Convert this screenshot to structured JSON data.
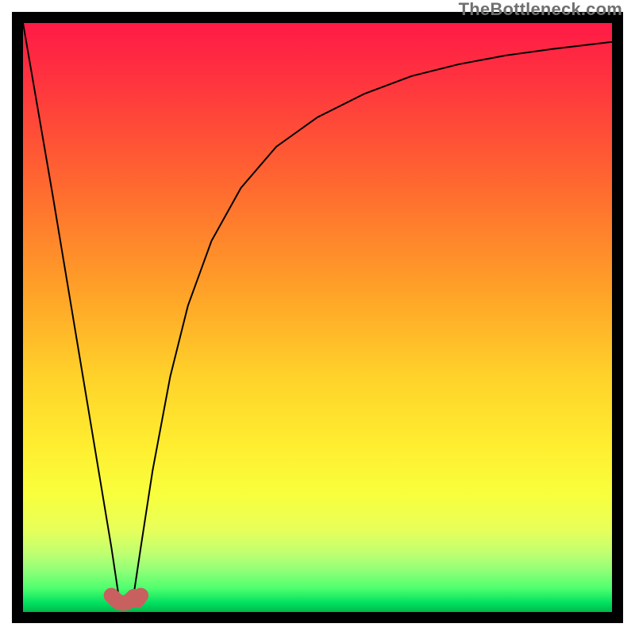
{
  "watermark": "TheBottleneck.com",
  "chart_data": {
    "type": "line",
    "title": "",
    "xlabel": "",
    "ylabel": "",
    "xlim": [
      0,
      100
    ],
    "ylim": [
      0,
      100
    ],
    "series": [
      {
        "name": "bottleneck-curve",
        "x": [
          0,
          5,
          10,
          13,
          15,
          16.2,
          17.5,
          18.8,
          20,
          22,
          25,
          28,
          32,
          37,
          43,
          50,
          58,
          66,
          74,
          82,
          90,
          100
        ],
        "values": [
          100,
          71,
          41,
          23,
          11,
          3,
          1.5,
          3,
          11,
          24,
          40,
          52,
          63,
          72,
          79,
          84,
          88,
          91,
          93,
          94.5,
          95.6,
          96.8
        ]
      },
      {
        "name": "highlight-band",
        "x": [
          15.0,
          15.8,
          16.4,
          17.0,
          17.6,
          18.2,
          18.8,
          19.4,
          20.0
        ],
        "values": [
          2.8,
          2.0,
          1.6,
          1.5,
          1.6,
          2.0,
          2.6,
          2.0,
          2.8
        ]
      }
    ],
    "annotations": []
  },
  "colors": {
    "curve": "#000000",
    "highlight": "#c86060",
    "frame": "#000000"
  }
}
